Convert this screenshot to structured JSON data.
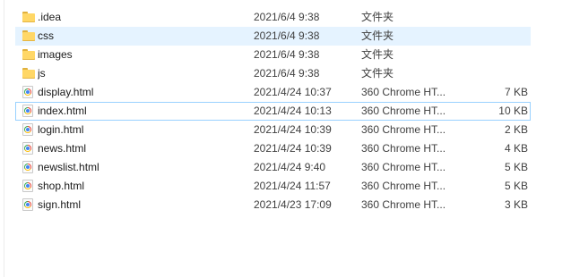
{
  "files": [
    {
      "name": ".idea",
      "date": "2021/6/4 9:38",
      "type": "文件夹",
      "size": "",
      "icon": "folder-icon",
      "kind": "folder"
    },
    {
      "name": "css",
      "date": "2021/6/4 9:38",
      "type": "文件夹",
      "size": "",
      "icon": "folder-icon",
      "kind": "folder"
    },
    {
      "name": "images",
      "date": "2021/6/4 9:38",
      "type": "文件夹",
      "size": "",
      "icon": "folder-icon",
      "kind": "folder"
    },
    {
      "name": "js",
      "date": "2021/6/4 9:38",
      "type": "文件夹",
      "size": "",
      "icon": "folder-icon",
      "kind": "folder"
    },
    {
      "name": "display.html",
      "date": "2021/4/24 10:37",
      "type": "360 Chrome HT...",
      "size": "7 KB",
      "icon": "chrome-html-file-icon",
      "kind": "file"
    },
    {
      "name": "index.html",
      "date": "2021/4/24 10:13",
      "type": "360 Chrome HT...",
      "size": "10 KB",
      "icon": "chrome-html-file-icon",
      "kind": "file"
    },
    {
      "name": "login.html",
      "date": "2021/4/24 10:39",
      "type": "360 Chrome HT...",
      "size": "2 KB",
      "icon": "chrome-html-file-icon",
      "kind": "file"
    },
    {
      "name": "news.html",
      "date": "2021/4/24 10:39",
      "type": "360 Chrome HT...",
      "size": "4 KB",
      "icon": "chrome-html-file-icon",
      "kind": "file"
    },
    {
      "name": "newslist.html",
      "date": "2021/4/24 9:40",
      "type": "360 Chrome HT...",
      "size": "5 KB",
      "icon": "chrome-html-file-icon",
      "kind": "file"
    },
    {
      "name": "shop.html",
      "date": "2021/4/24 11:57",
      "type": "360 Chrome HT...",
      "size": "5 KB",
      "icon": "chrome-html-file-icon",
      "kind": "file"
    },
    {
      "name": "sign.html",
      "date": "2021/4/23 17:09",
      "type": "360 Chrome HT...",
      "size": "3 KB",
      "icon": "chrome-html-file-icon",
      "kind": "file"
    }
  ],
  "hovered_index": 1,
  "selected_index": 5,
  "colors": {
    "hover_background": "#e5f3ff",
    "selected_border": "#99d1ff",
    "folder": "#ffd766"
  }
}
